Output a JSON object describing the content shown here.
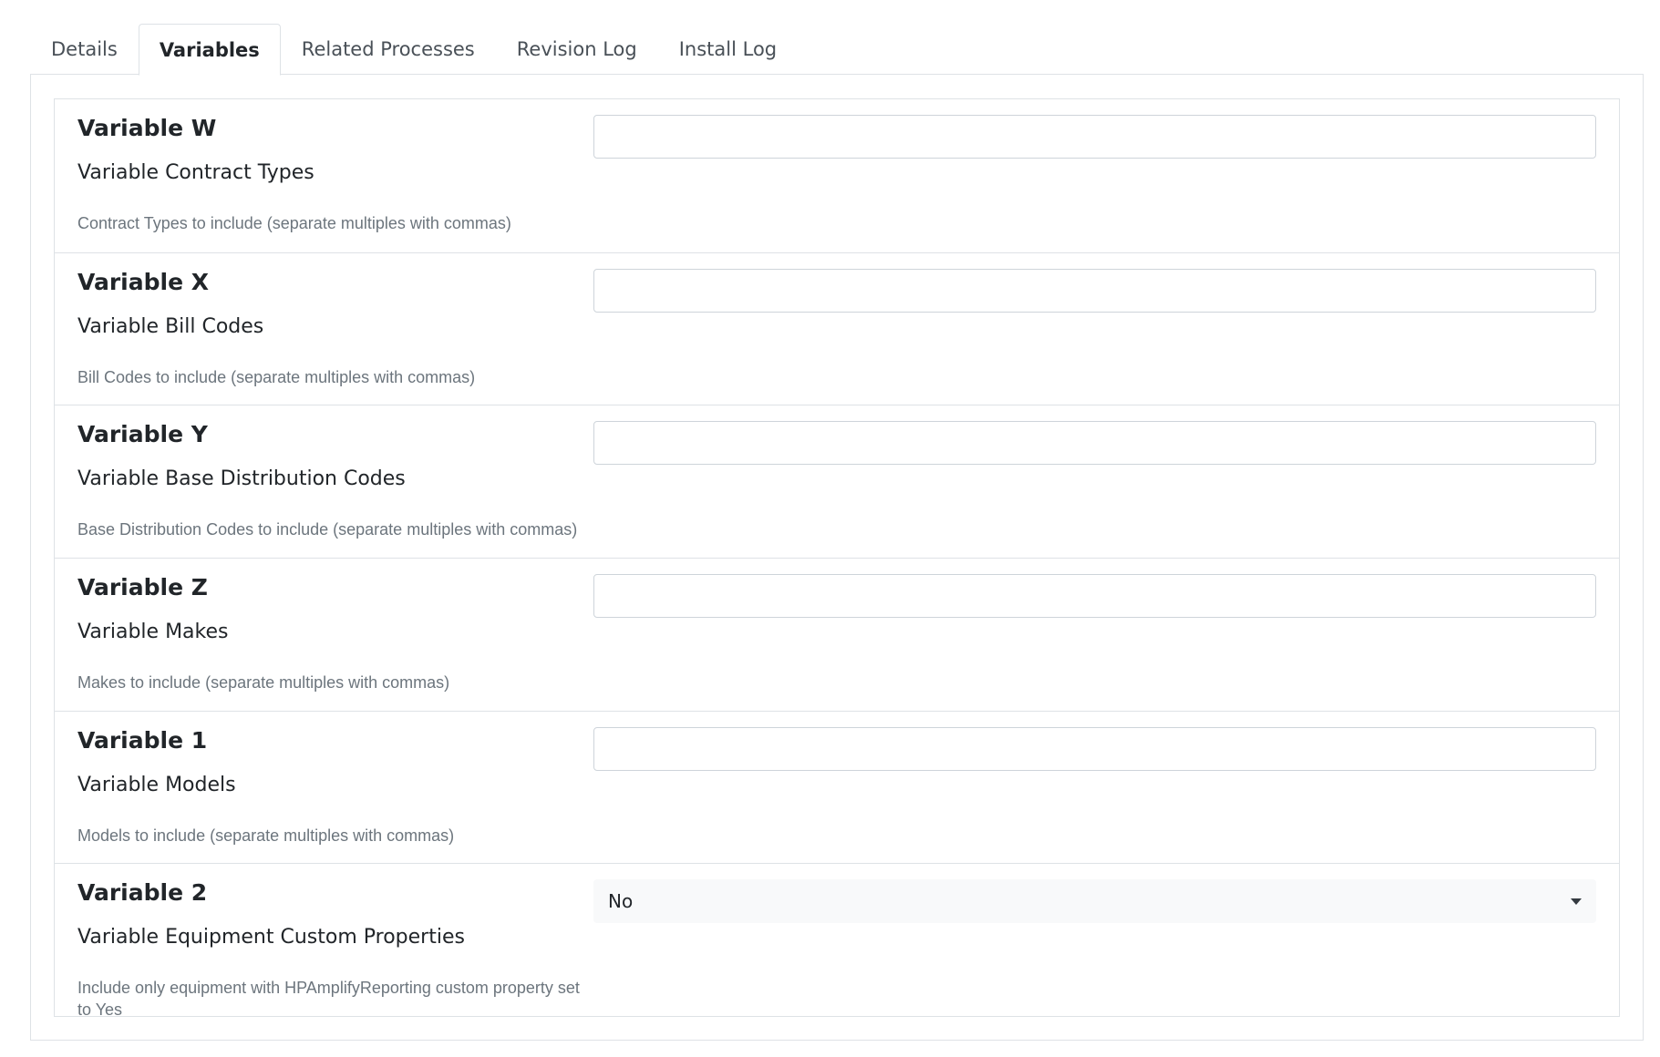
{
  "tabs": [
    {
      "label": "Details",
      "active": false
    },
    {
      "label": "Variables",
      "active": true
    },
    {
      "label": "Related Processes",
      "active": false
    },
    {
      "label": "Revision Log",
      "active": false
    },
    {
      "label": "Install Log",
      "active": false
    }
  ],
  "variables": [
    {
      "name": "Variable W",
      "title": "Variable Contract Types",
      "help": "Contract Types to include (separate multiples with commas)",
      "value": ""
    },
    {
      "name": "Variable X",
      "title": "Variable Bill Codes",
      "help": "Bill Codes to include (separate multiples with commas)",
      "value": ""
    },
    {
      "name": "Variable Y",
      "title": "Variable Base Distribution Codes",
      "help": "Base Distribution Codes to include (separate multiples with commas)",
      "value": ""
    },
    {
      "name": "Variable Z",
      "title": "Variable Makes",
      "help": "Makes to include (separate multiples with commas)",
      "value": ""
    },
    {
      "name": "Variable 1",
      "title": "Variable Models",
      "help": "Models to include (separate multiples with commas)",
      "value": ""
    },
    {
      "name": "Variable 2",
      "title": "Variable Equipment Custom Properties",
      "help": "Include only equipment with HPAmplifyReporting custom property set to Yes",
      "selected": "No",
      "icon": "chevron-down-icon"
    }
  ]
}
